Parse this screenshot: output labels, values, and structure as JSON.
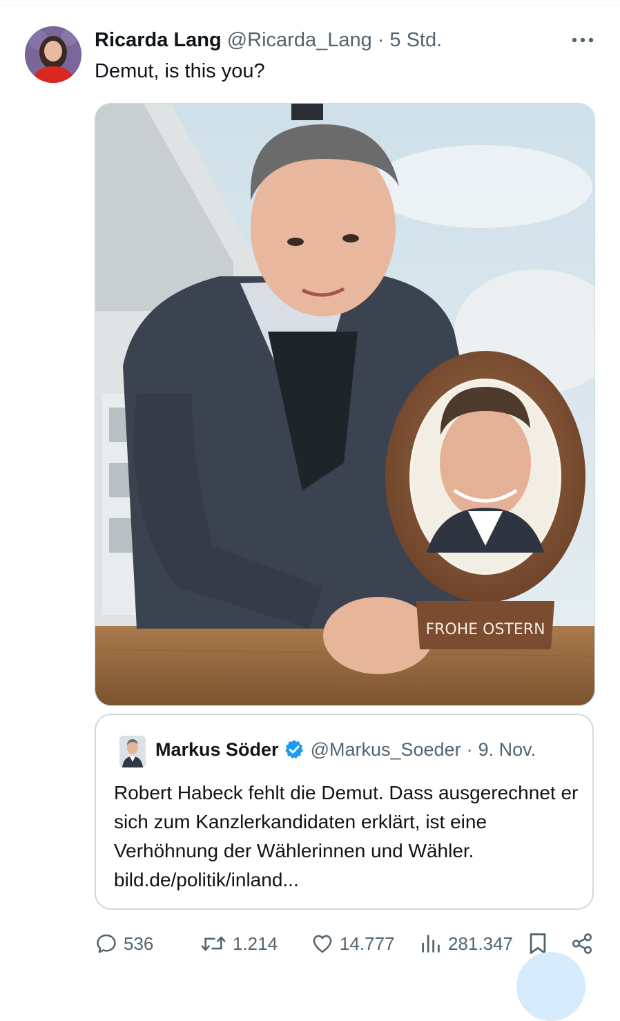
{
  "tweet": {
    "author_name": "Ricarda Lang",
    "author_handle": "@Ricarda_Lang",
    "separator": "·",
    "timestamp": "5 Std.",
    "text": "Demut, is this you?",
    "media_text": "FROHE OSTERN"
  },
  "quoted_tweet": {
    "author_name": "Markus Söder",
    "author_handle": "@Markus_Soeder",
    "separator": "·",
    "date": "9. Nov.",
    "text": "Robert Habeck fehlt die Demut. Dass ausgerechnet er sich zum Kanzlerkandidaten erklärt, ist eine Verhöhnung der Wählerinnen und Wähler.  bild.de/politik/inland..."
  },
  "actions": {
    "replies": "536",
    "retweets": "1.214",
    "likes": "14.777",
    "views": "281.347"
  },
  "colors": {
    "text": "#0f1419",
    "secondary": "#536471",
    "border": "#cfd9de",
    "verified": "#1d9bf0"
  }
}
